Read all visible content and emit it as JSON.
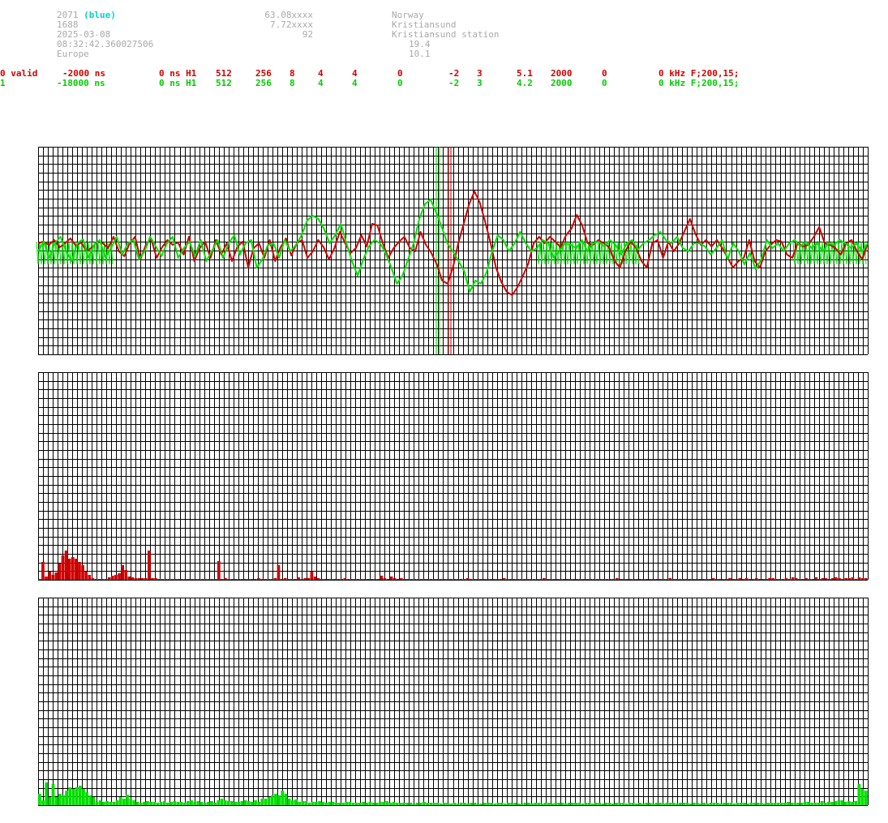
{
  "station": {
    "id": "2071",
    "color_tag": "(blue)",
    "line2": "1688",
    "date": "2025-03-08",
    "time": "08:32:42.360027506",
    "region": "Europe",
    "lat": "63.08xxxx",
    "lon": "7.72xxxx",
    "alt": "92",
    "country": "Norway",
    "city": "Kristiansund",
    "site": "Kristiansund station",
    "val1": "19.4",
    "val2": "10.1"
  },
  "channels": [
    {
      "c0": "0 valid",
      "c1": "-2000 ns",
      "c2": "0 ns H1",
      "c3": "512",
      "c4": "256",
      "c5": "8",
      "c6": "4",
      "c7": "4",
      "c8": "0",
      "c9": "-2",
      "c10": "3",
      "c11": "5.1",
      "c12": "2000",
      "c13": "0",
      "c14": "0 kHz F;200,15;"
    },
    {
      "c0": "1",
      "c1": "-18000 ns",
      "c2": "0 ns H1",
      "c3": "512",
      "c4": "256",
      "c5": "8",
      "c6": "4",
      "c7": "4",
      "c8": "0",
      "c9": "-2",
      "c10": "3",
      "c11": "4.2",
      "c12": "2000",
      "c13": "0",
      "c14": "0 kHz F;200,15;"
    }
  ],
  "colors": {
    "red": "#d00000",
    "green": "#00e000",
    "grid": "#000000"
  },
  "chart_data": [
    {
      "type": "line",
      "series": [
        {
          "color": "red",
          "values": [
            300,
            298,
            302,
            296,
            305,
            300,
            294,
            303,
            299,
            310,
            305,
            298,
            300,
            306,
            292,
            310,
            316,
            300,
            292,
            320,
            302,
            295,
            318,
            305,
            296,
            302,
            299,
            314,
            292,
            322,
            306,
            298,
            318,
            296,
            314,
            300,
            322,
            304,
            298,
            330,
            306,
            300,
            318,
            296,
            322,
            305,
            294,
            315,
            300,
            296,
            318,
            310,
            296,
            305,
            320,
            306,
            286,
            300,
            312,
            306,
            290,
            304,
            276,
            278,
            300,
            318,
            306,
            298,
            292,
            306,
            310,
            286,
            302,
            312,
            326,
            346,
            350,
            330,
            300,
            276,
            252,
            236,
            250,
            274,
            300,
            330,
            348,
            360,
            364,
            354,
            340,
            325,
            300,
            292,
            300,
            292,
            298,
            305,
            290,
            282,
            265,
            278,
            300,
            302,
            296,
            300,
            305,
            322,
            330,
            310,
            298,
            306,
            322,
            330,
            300,
            296,
            318,
            298,
            310,
            300,
            285,
            270,
            288,
            302,
            296,
            304,
            296,
            306,
            318,
            330,
            322,
            318,
            296,
            322,
            330,
            310,
            302,
            296,
            298,
            314,
            318,
            300,
            304,
            302,
            292,
            280,
            300,
            302,
            306,
            314,
            300,
            296,
            310,
            320,
            300
          ]
        },
        {
          "color": "green",
          "values": [
            310,
            298,
            318,
            300,
            292,
            310,
            322,
            300,
            295,
            318,
            302,
            296,
            318,
            306,
            292,
            314,
            300,
            296,
            320,
            310,
            292,
            304,
            316,
            300,
            292,
            318,
            306,
            298,
            316,
            296,
            322,
            310,
            296,
            318,
            300,
            290,
            314,
            300,
            296,
            330,
            320,
            302,
            300,
            318,
            296,
            310,
            302,
            290,
            272,
            266,
            270,
            282,
            300,
            290,
            276,
            300,
            322,
            340,
            320,
            304,
            296,
            300,
            312,
            330,
            350,
            340,
            320,
            300,
            270,
            252,
            246,
            262,
            280,
            300,
            310,
            322,
            334,
            360,
            346,
            350,
            336,
            310,
            290,
            296,
            310,
            300,
            286,
            300,
            310,
            306,
            296,
            300,
            318,
            310,
            300,
            302,
            306,
            296,
            310,
            300,
            298,
            304,
            296,
            302,
            314,
            300,
            296,
            308,
            300,
            296,
            290,
            286,
            296,
            300,
            292,
            306,
            310,
            300,
            300,
            304,
            314,
            306,
            296,
            320,
            300,
            310,
            326,
            312,
            332,
            320,
            296,
            306,
            300,
            310,
            300,
            296,
            304,
            298,
            306,
            300,
            310,
            300,
            302,
            296,
            300,
            306,
            300,
            310,
            300
          ]
        }
      ]
    },
    {
      "type": "bar",
      "series": [
        {
          "color": "red",
          "values": [
            1,
            22,
            4,
            10,
            6,
            9,
            20,
            30,
            36,
            26,
            28,
            26,
            22,
            18,
            10,
            6,
            2,
            1,
            1,
            1,
            1,
            3,
            5,
            6,
            8,
            18,
            12,
            4,
            3,
            2,
            2,
            2,
            2,
            36,
            2,
            2,
            1,
            1,
            1,
            1,
            1,
            1,
            1,
            1,
            1,
            1,
            1,
            1,
            1,
            1,
            1,
            1,
            1,
            1,
            23,
            1,
            2,
            1,
            1,
            1,
            1,
            1,
            1,
            1,
            1,
            1,
            2,
            1,
            1,
            1,
            1,
            2,
            18,
            1,
            2,
            1,
            1,
            1,
            3,
            1,
            2,
            2,
            10,
            4,
            2,
            1,
            1,
            1,
            1,
            1,
            1,
            1,
            2,
            1,
            1,
            1,
            1,
            1,
            1,
            1,
            1,
            1,
            1,
            5,
            2,
            1,
            4,
            2,
            1,
            2,
            1,
            1,
            1,
            1,
            1,
            1,
            1,
            1,
            1,
            1,
            1,
            1,
            1,
            1,
            1,
            1,
            1,
            1,
            1,
            2,
            1,
            1,
            1,
            1,
            1,
            1,
            1,
            1,
            1,
            1,
            2,
            1,
            1,
            1,
            1,
            1,
            1,
            1,
            1,
            1,
            1,
            1,
            2,
            1,
            1,
            1,
            1,
            1,
            1,
            1,
            1,
            1,
            1,
            1,
            1,
            1,
            1,
            1,
            1,
            1,
            1,
            1,
            1,
            1,
            2,
            1,
            1,
            1,
            1,
            1,
            1,
            1,
            1,
            1,
            1,
            1,
            1,
            1,
            1,
            1,
            2,
            1,
            1,
            1,
            1,
            1,
            1,
            1,
            1,
            1,
            1,
            1,
            1,
            2,
            1,
            1,
            1,
            1,
            2,
            1,
            1,
            2,
            1,
            2,
            1,
            1,
            2,
            1,
            1,
            1,
            2,
            2,
            1,
            1,
            1,
            2,
            1,
            3,
            2,
            1,
            1,
            2,
            1,
            1,
            3,
            1,
            2,
            2,
            1,
            2,
            3,
            2,
            1,
            2,
            2,
            3,
            1,
            3,
            2,
            2
          ]
        }
      ]
    },
    {
      "type": "bar",
      "series": [
        {
          "color": "green",
          "values": [
            14,
            6,
            28,
            10,
            26,
            10,
            14,
            12,
            18,
            22,
            20,
            22,
            24,
            20,
            16,
            12,
            10,
            4,
            6,
            4,
            5,
            4,
            4,
            6,
            10,
            8,
            13,
            8,
            6,
            4,
            3,
            4,
            5,
            4,
            4,
            3,
            4,
            5,
            3,
            4,
            5,
            4,
            4,
            3,
            5,
            6,
            4,
            5,
            4,
            3,
            4,
            5,
            3,
            6,
            8,
            6,
            5,
            5,
            4,
            4,
            5,
            6,
            5,
            4,
            6,
            4,
            8,
            8,
            10,
            12,
            14,
            12,
            18,
            14,
            8,
            6,
            7,
            4,
            5,
            5,
            3,
            4,
            4,
            5,
            4,
            3,
            4,
            4,
            3,
            3,
            3,
            4,
            4,
            3,
            3,
            3,
            4,
            3,
            4,
            3,
            3,
            4,
            4,
            5,
            3,
            4,
            3,
            3,
            3,
            3,
            3,
            2,
            3,
            3,
            4,
            3,
            3,
            3,
            3,
            2,
            3,
            3,
            2,
            3,
            2,
            3,
            3,
            2,
            3,
            3,
            2,
            2,
            3,
            3,
            3,
            2,
            3,
            3,
            2,
            3,
            3,
            3,
            2,
            2,
            3,
            3,
            2,
            3,
            3,
            2,
            3,
            3,
            2,
            3,
            3,
            3,
            2,
            3,
            3,
            3,
            3,
            2,
            3,
            3,
            2,
            3,
            3,
            2,
            3,
            3,
            2,
            3,
            3,
            3,
            2,
            3,
            3,
            2,
            3,
            2,
            3,
            3,
            2,
            3,
            3,
            2,
            3,
            3,
            3,
            2,
            3,
            3,
            3,
            2,
            3,
            3,
            2,
            3,
            2,
            3,
            3,
            3,
            2,
            3,
            3,
            3,
            2,
            3,
            3,
            3,
            2,
            3,
            3,
            3,
            3,
            2,
            3,
            3,
            3,
            3,
            3,
            3,
            4,
            3,
            3,
            3,
            3,
            4,
            4,
            3,
            3,
            3,
            5,
            3,
            4,
            4,
            5,
            6,
            6,
            4,
            5,
            4,
            5,
            26,
            20,
            18
          ]
        }
      ]
    }
  ]
}
